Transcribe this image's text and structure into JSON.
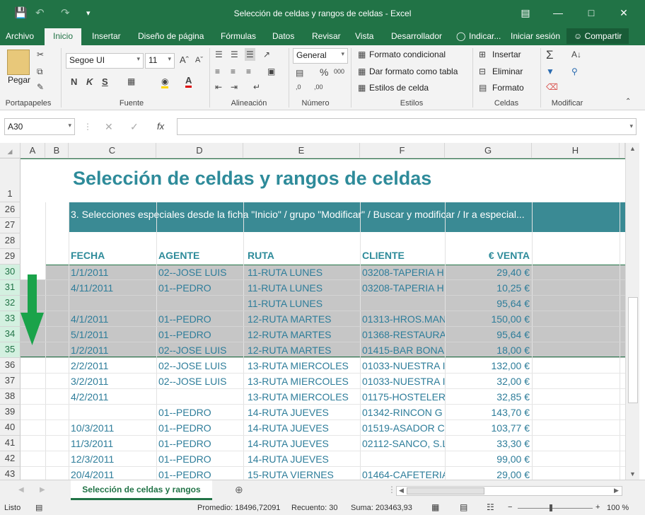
{
  "window": {
    "title": "Selección de celdas y rangos de celdas - Excel"
  },
  "tabs": [
    {
      "label": "Archivo"
    },
    {
      "label": "Inicio"
    },
    {
      "label": "Insertar"
    },
    {
      "label": "Diseño de página"
    },
    {
      "label": "Fórmulas"
    },
    {
      "label": "Datos"
    },
    {
      "label": "Revisar"
    },
    {
      "label": "Vista"
    },
    {
      "label": "Desarrollador"
    },
    {
      "label": "Indicar..."
    },
    {
      "label": "Iniciar sesión"
    }
  ],
  "share_label": "Compartir",
  "ribbon": {
    "paste": "Pegar",
    "font_name": "Segoe UI",
    "font_size": "11",
    "number_format": "General",
    "cond_format": "Formato condicional",
    "format_table": "Dar formato como tabla",
    "cell_styles": "Estilos de celda",
    "insert": "Insertar",
    "delete": "Eliminar",
    "format": "Formato",
    "groups": {
      "clipboard": "Portapapeles",
      "font": "Fuente",
      "alignment": "Alineación",
      "number": "Número",
      "styles": "Estilos",
      "cells": "Celdas",
      "editing": "Modificar"
    }
  },
  "formula_bar": {
    "name_box": "A30",
    "formula": ""
  },
  "columns": [
    "A",
    "B",
    "C",
    "D",
    "E",
    "F",
    "G",
    "H"
  ],
  "sheet": {
    "title": "Selección de celdas y rangos de celdas",
    "banner": "3. Selecciones especiales desde la ficha \"Inicio\" / grupo \"Modificar\" / Buscar y modificar / Ir a especial...",
    "headers": {
      "fecha": "FECHA",
      "agente": "AGENTE",
      "ruta": "RUTA",
      "cliente": "CLIENTE",
      "venta": "€ VENTA"
    },
    "rows": [
      {
        "n": "30",
        "fecha": "1/1/2011",
        "agente": "02--JOSE LUIS",
        "ruta": "11-RUTA LUNES",
        "cliente": "03208-TAPERIA H",
        "venta": "29,40 €"
      },
      {
        "n": "31",
        "fecha": "4/11/2011",
        "agente": "01--PEDRO",
        "ruta": "11-RUTA LUNES",
        "cliente": "03208-TAPERIA H",
        "venta": "10,25 €"
      },
      {
        "n": "32",
        "fecha": "",
        "agente": "",
        "ruta": "11-RUTA LUNES",
        "cliente": "",
        "venta": "95,64 €"
      },
      {
        "n": "33",
        "fecha": "4/1/2011",
        "agente": "01--PEDRO",
        "ruta": "12-RUTA MARTES",
        "cliente": "01313-HROS.MAN",
        "venta": "150,00 €"
      },
      {
        "n": "34",
        "fecha": "5/1/2011",
        "agente": "01--PEDRO",
        "ruta": "12-RUTA MARTES",
        "cliente": "01368-RESTAURA",
        "venta": "95,64 €"
      },
      {
        "n": "35",
        "fecha": "1/2/2011",
        "agente": "02--JOSE LUIS",
        "ruta": "12-RUTA MARTES",
        "cliente": "01415-BAR BONA",
        "venta": "18,00 €"
      },
      {
        "n": "36",
        "fecha": "2/2/2011",
        "agente": "02--JOSE LUIS",
        "ruta": "13-RUTA MIERCOLES",
        "cliente": "01033-NUESTRA I",
        "venta": "132,00 €"
      },
      {
        "n": "37",
        "fecha": "3/2/2011",
        "agente": "02--JOSE LUIS",
        "ruta": "13-RUTA MIERCOLES",
        "cliente": "01033-NUESTRA I",
        "venta": "32,00 €"
      },
      {
        "n": "38",
        "fecha": "4/2/2011",
        "agente": "",
        "ruta": "13-RUTA MIERCOLES",
        "cliente": "01175-HOSTELER",
        "venta": "32,85 €"
      },
      {
        "n": "39",
        "fecha": "",
        "agente": "01--PEDRO",
        "ruta": "14-RUTA JUEVES",
        "cliente": "01342-RINCON G",
        "venta": "143,70 €"
      },
      {
        "n": "40",
        "fecha": "10/3/2011",
        "agente": "01--PEDRO",
        "ruta": "14-RUTA JUEVES",
        "cliente": "01519-ASADOR C",
        "venta": "103,77 €"
      },
      {
        "n": "41",
        "fecha": "11/3/2011",
        "agente": "01--PEDRO",
        "ruta": "14-RUTA JUEVES",
        "cliente": "02112-SANCO, S.L",
        "venta": "33,30 €"
      },
      {
        "n": "42",
        "fecha": "12/3/2011",
        "agente": "01--PEDRO",
        "ruta": "14-RUTA JUEVES",
        "cliente": "",
        "venta": "99,00 €"
      },
      {
        "n": "43",
        "fecha": "20/4/2011",
        "agente": "01--PEDRO",
        "ruta": "15-RUTA VIERNES",
        "cliente": "01464-CAFETERIA",
        "venta": "29,00 €"
      }
    ]
  },
  "sheet_tab": "Selección de celdas y rangos",
  "status": {
    "ready": "Listo",
    "average": "Promedio: 18496,72091",
    "count": "Recuento: 30",
    "sum": "Suma: 203463,93",
    "zoom": "100 %"
  },
  "colors": {
    "excel_green": "#217346",
    "banner": "#3a8a94",
    "selection": "#c6c6c6",
    "arrow": "#1aa34a"
  }
}
